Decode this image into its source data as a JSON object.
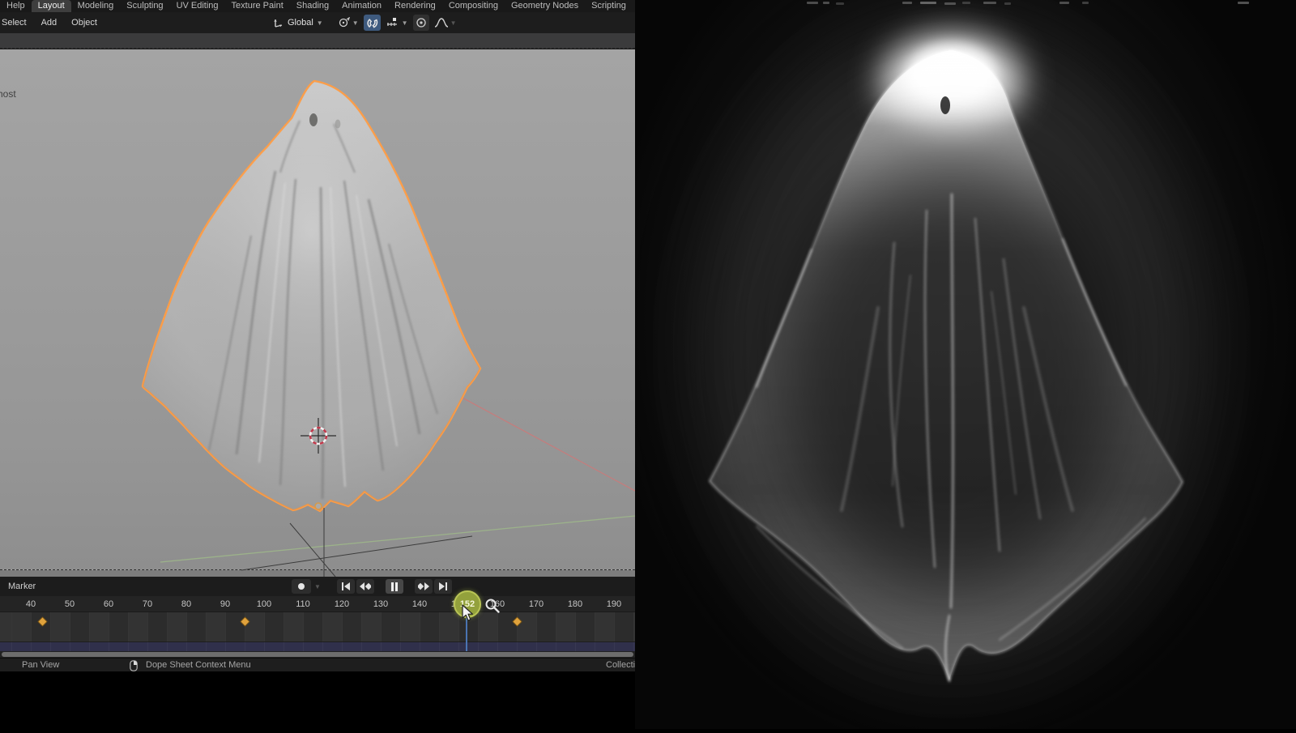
{
  "topbar": {
    "workspaces": [
      "Help",
      "Layout",
      "Modeling",
      "Sculpting",
      "UV Editing",
      "Texture Paint",
      "Shading",
      "Animation",
      "Rendering",
      "Compositing",
      "Geometry Nodes",
      "Scripting"
    ],
    "active_workspace": "Layout"
  },
  "viewport_header": {
    "menus": [
      "Select",
      "Add",
      "Object"
    ],
    "transform_orientation": "Global",
    "icons": [
      "transform-orientation-icon",
      "pivot-point-icon",
      "snap-magnet-icon",
      "snap-target-increment-icon",
      "proportional-editing-icon",
      "falloff-curve-icon"
    ]
  },
  "viewport": {
    "object_label": "host",
    "overlays": [
      "3d-cursor",
      "object-origin",
      "selection-outline"
    ]
  },
  "timeline": {
    "marker_menu": "Marker",
    "current_frame": "152",
    "ticks": [
      "40",
      "50",
      "60",
      "70",
      "80",
      "90",
      "100",
      "110",
      "120",
      "130",
      "140",
      "150",
      "160",
      "170",
      "180",
      "190"
    ],
    "keyframe_frames": [
      43,
      95,
      165
    ],
    "playback_buttons": [
      "jump-to-start",
      "previous-keyframe",
      "pause",
      "next-keyframe",
      "jump-to-end"
    ],
    "autokey_button": "auto-keying-record"
  },
  "statusbar": {
    "pan": "Pan View",
    "context": "Dope Sheet Context Menu",
    "right": "Collecti"
  },
  "colors": {
    "frame_badge": "#93a13c",
    "playhead": "#4a74b2",
    "keyframe": "#e0a23c",
    "selection_outline": "#ff9d45"
  }
}
